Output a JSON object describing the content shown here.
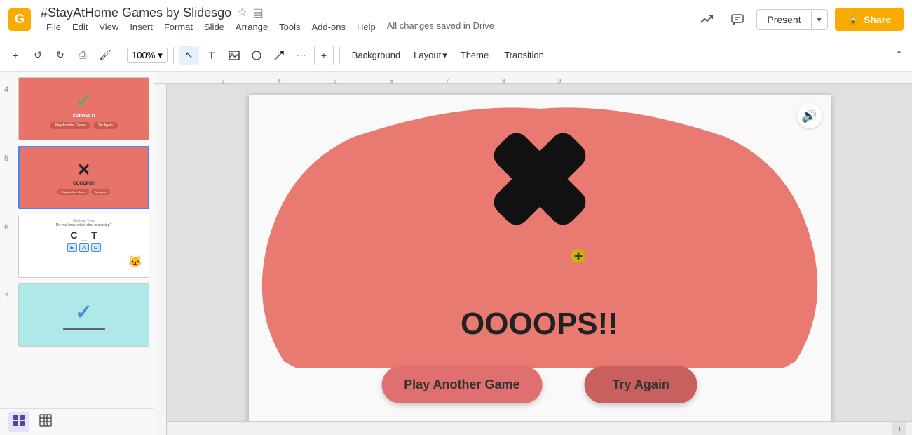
{
  "app": {
    "icon": "G",
    "title": "#StayAtHome Games by Slidesgo",
    "autosave": "All changes saved in Drive"
  },
  "menu": {
    "items": [
      "File",
      "Edit",
      "View",
      "Insert",
      "Format",
      "Slide",
      "Arrange",
      "Tools",
      "Add-ons",
      "Help"
    ]
  },
  "toolbar": {
    "background_label": "Background",
    "layout_label": "Layout",
    "theme_label": "Theme",
    "transition_label": "Transition"
  },
  "header": {
    "present_label": "Present",
    "share_label": "Share"
  },
  "slide": {
    "oops_text": "OOOOPS!!",
    "play_another_game": "Play Another Game",
    "try_again": "Try Again"
  },
  "slides_panel": {
    "items": [
      {
        "num": "4",
        "type": "correct"
      },
      {
        "num": "5",
        "type": "wrong"
      },
      {
        "num": "6",
        "type": "letter"
      },
      {
        "num": "7",
        "type": "blue"
      }
    ]
  },
  "icons": {
    "sound": "🔊",
    "star": "☆",
    "docs": "▤",
    "trend": "📈",
    "comment": "💬",
    "lock": "🔒",
    "chevron_down": "▾",
    "collapse": "⌃",
    "plus": "+",
    "undo": "↺",
    "redo": "↻",
    "print": "⎙",
    "paint": "🖌",
    "zoom": "100%",
    "cursor": "↖",
    "textbox": "T",
    "image": "🖼",
    "shape": "○",
    "line": "╱",
    "more": "⋯",
    "insert": "+",
    "grid": "⊞",
    "slides": "▦"
  }
}
